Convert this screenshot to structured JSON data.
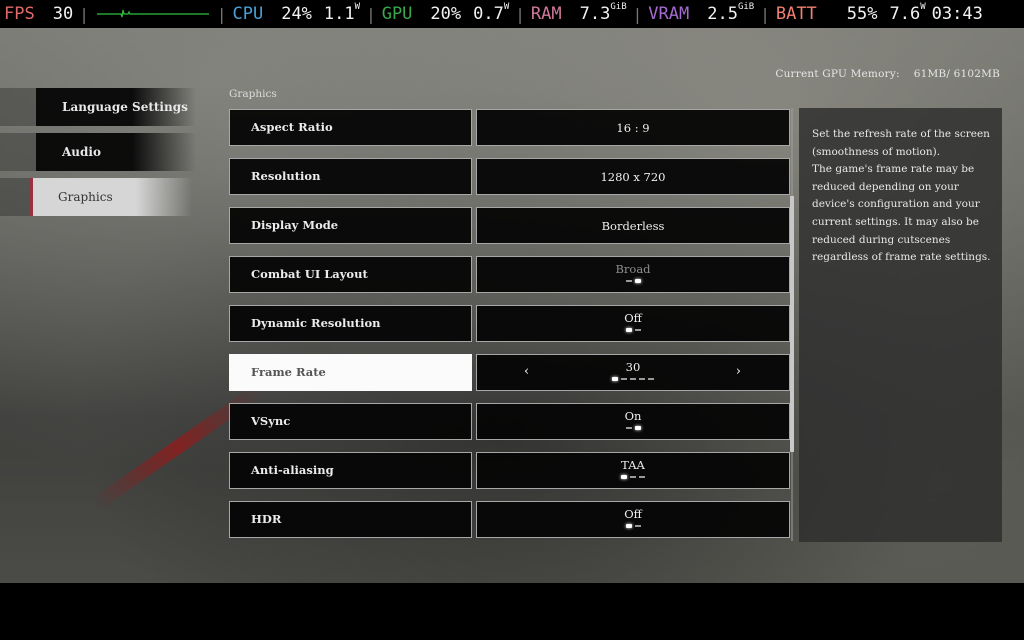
{
  "perf_overlay": {
    "fps": {
      "label": "FPS",
      "value": "30",
      "label_color": "#e06a6a"
    },
    "cpu": {
      "label": "CPU",
      "usage": "24%",
      "power": "1.1",
      "power_unit": "W",
      "label_color": "#4a9fd8"
    },
    "gpu": {
      "label": "GPU",
      "usage": "20%",
      "power": "0.7",
      "power_unit": "W",
      "label_color": "#3aa84a"
    },
    "ram": {
      "label": "RAM",
      "value": "7.3",
      "unit": "GiB",
      "label_color": "#d07a9a"
    },
    "vram": {
      "label": "VRAM",
      "value": "2.5",
      "unit": "GiB",
      "label_color": "#a56ad0"
    },
    "batt": {
      "label": "BATT",
      "percent": "55%",
      "power": "7.6",
      "power_unit": "W",
      "label_color": "#f08070"
    },
    "clock": "03:43",
    "frametime_graph_color": "#2fbf3f"
  },
  "gpu_memory": {
    "label": "Current GPU Memory:",
    "value": "61MB/ 6102MB"
  },
  "nav": {
    "items": [
      {
        "label": "Language Settings",
        "active": false
      },
      {
        "label": "Audio",
        "active": false
      },
      {
        "label": "Graphics",
        "active": true
      }
    ],
    "accent_color": "#9a3140"
  },
  "section": {
    "title": "Graphics",
    "settings": [
      {
        "name": "Aspect Ratio",
        "value": "16 : 9"
      },
      {
        "name": "Resolution",
        "value": "1280 x 720"
      },
      {
        "name": "Display Mode",
        "value": "Borderless"
      },
      {
        "name": "Combat UI Layout",
        "value": "Broad",
        "options_count": 2,
        "selected_index": 1,
        "disabled": true
      },
      {
        "name": "Dynamic Resolution",
        "value": "Off",
        "options_count": 2,
        "selected_index": 0
      },
      {
        "name": "Frame Rate",
        "value": "30",
        "options_count": 5,
        "selected_index": 0,
        "selected": true,
        "arrows": {
          "left": "‹",
          "right": "›"
        }
      },
      {
        "name": "VSync",
        "value": "On",
        "options_count": 2,
        "selected_index": 1
      },
      {
        "name": "Anti-aliasing",
        "value": "TAA",
        "options_count": 3,
        "selected_index": 0
      },
      {
        "name": "HDR",
        "value": "Off",
        "options_count": 2,
        "selected_index": 0
      }
    ]
  },
  "description": "Set the refresh rate of the screen (smoothness of motion).\nThe game's frame rate may be reduced depending on your device's configuration and your current settings. It may also be reduced during cutscenes regardless of frame rate settings."
}
